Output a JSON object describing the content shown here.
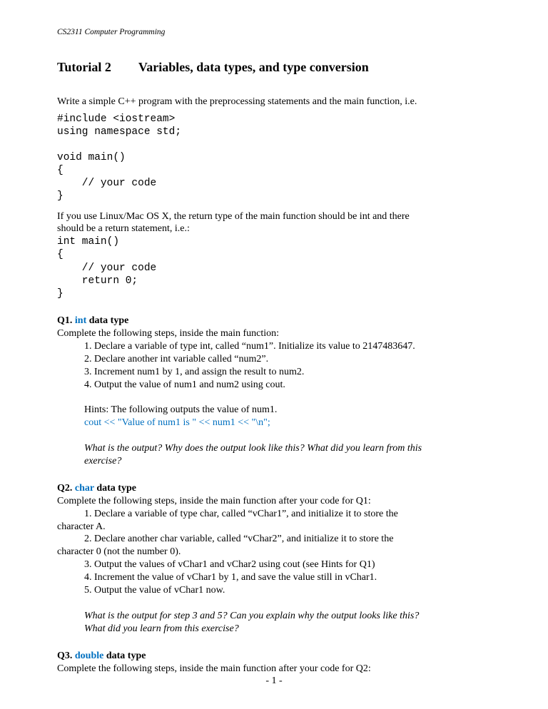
{
  "header": "CS2311 Computer Programming",
  "title_left": "Tutorial 2",
  "title_right": "Variables, data types, and type conversion",
  "intro": "Write a simple C++ program with the preprocessing statements and the main function, i.e.",
  "code1": "#include <iostream>\nusing namespace std;\n\nvoid main()\n{\n    // your code\n}",
  "para2a": "If you use Linux/Mac OS X, the return type of the main function should be int and there",
  "para2b": "should be a return statement, i.e.:",
  "code2": "int main()\n{\n    // your code\n    return 0;\n}",
  "q1": {
    "label": "Q1.",
    "kw": "int",
    "suffix": " data type",
    "lead": "Complete the following steps, inside the main function:",
    "s1": "1. Declare a variable of type int, called “num1”. Initialize its value to 2147483647.",
    "s2": "2. Declare another int variable called “num2”.",
    "s3": "3. Increment num1 by 1, and assign the result to num2.",
    "s4": "4. Output the value of num1 and num2 using cout.",
    "hint_lead": "Hints: The following outputs the value of num1.",
    "hint_code": "cout << \"Value of num1 is \" << num1 << \"\\n\";",
    "reflect1": "What is the output? Why does the output look like this? What did you learn from this",
    "reflect2": "exercise?"
  },
  "q2": {
    "label": "Q2.",
    "kw": "char",
    "suffix": " data type",
    "lead": "Complete the following steps, inside the main function after your code for Q1:",
    "s1a": "1. Declare a variable of type char, called “vChar1”, and initialize it to store the",
    "s1b": "character A.",
    "s2a": "2. Declare another char variable, called “vChar2”, and initialize it to store the",
    "s2b": "character 0 (not the number 0).",
    "s3": "3. Output the values of vChar1 and vChar2 using cout (see Hints for Q1)",
    "s4": "4. Increment the value of vChar1 by 1, and save the value still in vChar1.",
    "s5": "5. Output the value of vChar1 now.",
    "reflect1": "What is the output for step 3 and 5? Can you explain why the output looks like this?",
    "reflect2": "What did you learn from this exercise?"
  },
  "q3": {
    "label": "Q3.",
    "kw": "double",
    "suffix": " data type",
    "lead": "Complete the following steps, inside the main function after your code for Q2:"
  },
  "page_no": "- 1 -"
}
